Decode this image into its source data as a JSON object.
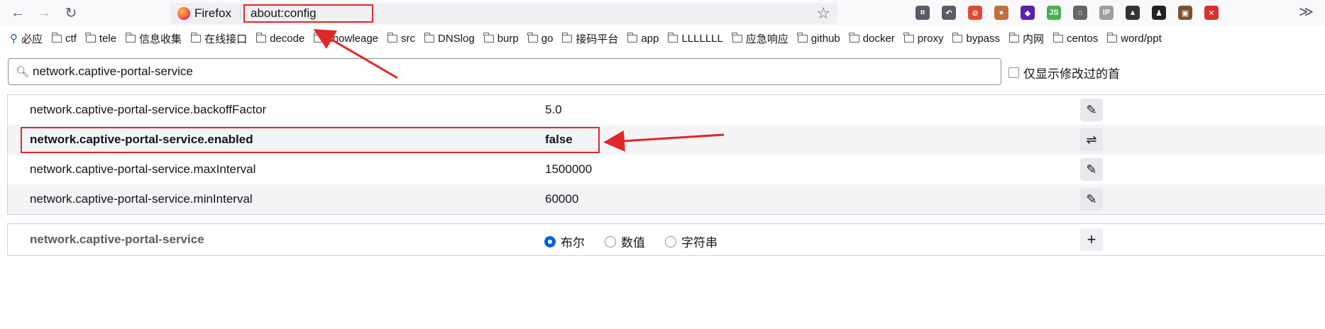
{
  "toolbar": {
    "tab_title": "Firefox",
    "url": "about:config",
    "bookmark_star_glyph": "☆",
    "overflow_glyph": "≫"
  },
  "extensions": [
    {
      "icon": "crop-icon",
      "color": "#5b5b66",
      "glyph": "⌗"
    },
    {
      "icon": "undo-icon",
      "color": "#5b5b66",
      "glyph": "↶"
    },
    {
      "icon": "noscript-icon",
      "color": "#e04b2f",
      "glyph": "⊘"
    },
    {
      "icon": "cookie-icon",
      "color": "#c0703a",
      "glyph": "●"
    },
    {
      "icon": "cube-icon",
      "color": "#5a1fb5",
      "glyph": "◆"
    },
    {
      "icon": "js-icon",
      "color": "#4caf50",
      "glyph": "JS"
    },
    {
      "icon": "robot-icon",
      "color": "#666666",
      "glyph": "⌂"
    },
    {
      "icon": "ip-icon",
      "color": "#9e9e9e",
      "glyph": "IP"
    },
    {
      "icon": "hat-icon",
      "color": "#333333",
      "glyph": "▲"
    },
    {
      "icon": "hacker-icon",
      "color": "#222222",
      "glyph": "♟"
    },
    {
      "icon": "download-icon",
      "color": "#7a5230",
      "glyph": "▣"
    },
    {
      "icon": "stop-icon",
      "color": "#d9302c",
      "glyph": "✕"
    }
  ],
  "bookmarks": [
    {
      "label": "必应",
      "type": "search"
    },
    {
      "label": "ctf",
      "type": "folder"
    },
    {
      "label": "tele",
      "type": "folder"
    },
    {
      "label": "信息收集",
      "type": "folder"
    },
    {
      "label": "在线接口",
      "type": "folder"
    },
    {
      "label": "decode",
      "type": "folder"
    },
    {
      "label": "knowleage",
      "type": "folder"
    },
    {
      "label": "src",
      "type": "folder"
    },
    {
      "label": "DNSlog",
      "type": "folder"
    },
    {
      "label": "burp",
      "type": "folder"
    },
    {
      "label": "go",
      "type": "folder"
    },
    {
      "label": "接码平台",
      "type": "folder"
    },
    {
      "label": "app",
      "type": "folder"
    },
    {
      "label": "LLLLLLL",
      "type": "folder"
    },
    {
      "label": "应急响应",
      "type": "folder"
    },
    {
      "label": "github",
      "type": "folder"
    },
    {
      "label": "docker",
      "type": "folder"
    },
    {
      "label": "proxy",
      "type": "folder"
    },
    {
      "label": "bypass",
      "type": "folder"
    },
    {
      "label": "内网",
      "type": "folder"
    },
    {
      "label": "centos",
      "type": "folder"
    },
    {
      "label": "word/ppt",
      "type": "folder"
    }
  ],
  "search": {
    "value": "network.captive-portal-service"
  },
  "modified_only_label": "仅显示修改过的首",
  "prefs": [
    {
      "name": "network.captive-portal-service.backoffFactor",
      "value": "5.0",
      "modified": false,
      "action": "edit",
      "action_glyph": "✎"
    },
    {
      "name": "network.captive-portal-service.enabled",
      "value": "false",
      "modified": true,
      "action": "toggle",
      "action_glyph": "⇌"
    },
    {
      "name": "network.captive-portal-service.maxInterval",
      "value": "1500000",
      "modified": false,
      "action": "edit",
      "action_glyph": "✎"
    },
    {
      "name": "network.captive-portal-service.minInterval",
      "value": "60000",
      "modified": false,
      "action": "edit",
      "action_glyph": "✎"
    }
  ],
  "add_row": {
    "name": "network.captive-portal-service",
    "types": [
      {
        "label": "布尔",
        "checked": true
      },
      {
        "label": "数值",
        "checked": false
      },
      {
        "label": "字符串",
        "checked": false
      }
    ],
    "add_glyph": "+"
  },
  "colors": {
    "annotation_red": "#e02828",
    "accent_blue": "#0061e0"
  }
}
